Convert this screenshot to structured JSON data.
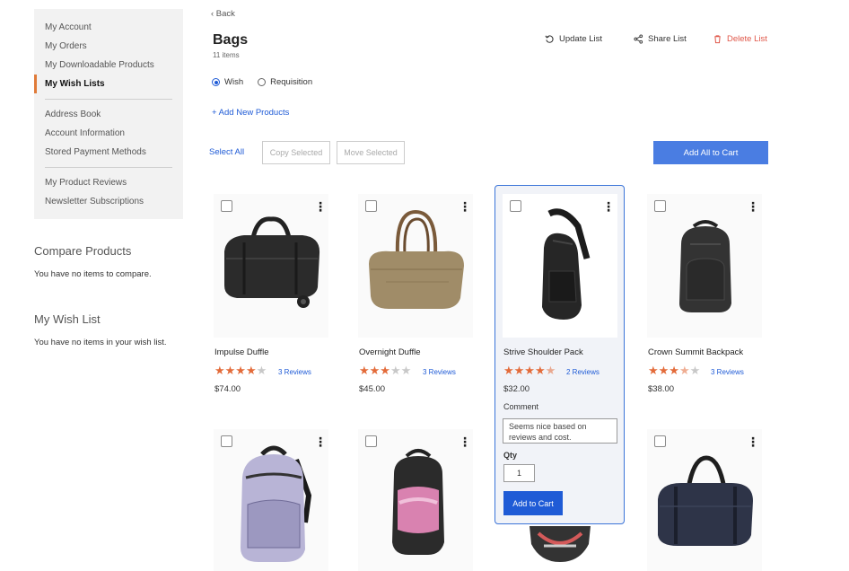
{
  "sidebar": {
    "group1": [
      "My Account",
      "My Orders",
      "My Downloadable Products",
      "My Wish Lists"
    ],
    "group2": [
      "Address Book",
      "Account Information",
      "Stored Payment Methods"
    ],
    "group3": [
      "My Product Reviews",
      "Newsletter Subscriptions"
    ],
    "active": "My Wish Lists"
  },
  "compare": {
    "title": "Compare Products",
    "text": "You have no items to compare."
  },
  "wishlist_block": {
    "title": "My Wish List",
    "text": "You have no items in your wish list."
  },
  "header": {
    "back": "‹ Back",
    "title": "Bags",
    "count": "11 items",
    "update": "Update List",
    "share": "Share List",
    "delete": "Delete List"
  },
  "list_type": {
    "wish": "Wish",
    "requisition": "Requisition",
    "selected": "Wish"
  },
  "add_new": "+ Add New Products",
  "toolbar": {
    "select_all": "Select All",
    "copy": "Copy Selected",
    "move": "Move Selected",
    "add_all": "Add All to Cart"
  },
  "products": [
    {
      "name": "Impulse Duffle",
      "rating": 4,
      "reviews": "3 Reviews",
      "price": "$74.00"
    },
    {
      "name": "Overnight Duffle",
      "rating": 3,
      "reviews": "3 Reviews",
      "price": "$45.00"
    },
    {
      "name": "Strive Shoulder Pack",
      "rating": 4.5,
      "reviews": "2 Reviews",
      "price": "$32.00",
      "comment_label": "Comment",
      "comment": "Seems nice based on reviews and cost.",
      "qty_label": "Qty",
      "qty": "1",
      "add_to_cart": "Add to Cart"
    },
    {
      "name": "Crown Summit Backpack",
      "rating": 3.5,
      "reviews": "3 Reviews",
      "price": "$38.00"
    }
  ],
  "colors": {
    "accent": "#1f5bd6",
    "primary_button": "#4a7de2",
    "star": "#e36b3a",
    "delete": "#e0584a",
    "active_marker": "#e07b39"
  }
}
